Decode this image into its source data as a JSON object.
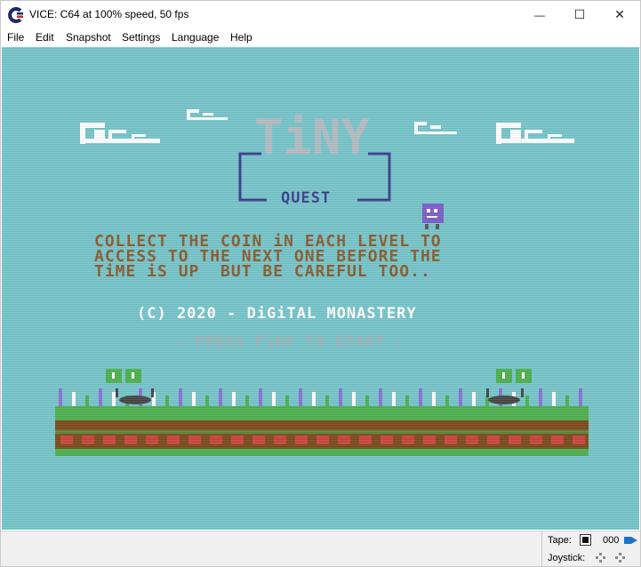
{
  "window": {
    "title": "VICE: C64 at 100% speed, 50 fps",
    "minimize_glyph": "—",
    "maximize_glyph": "☐",
    "close_glyph": "✕"
  },
  "menu": [
    {
      "label": "File"
    },
    {
      "label": "Edit"
    },
    {
      "label": "Snapshot"
    },
    {
      "label": "Settings"
    },
    {
      "label": "Language"
    },
    {
      "label": "Help"
    }
  ],
  "game": {
    "logo_title": "TiNY",
    "logo_subtitle": "QUEST",
    "instructions": [
      "COLLECT THE COIN iN EACH LEVEL TO",
      "ACCESS TO THE NEXT ONE BEFORE THE",
      "TiME iS UP  BUT BE CAREFUL TOO.."
    ],
    "copyright": "(C) 2020 - DiGiTAL MONASTERY",
    "press_fire": "- PRESS FiRE TO START -"
  },
  "status": {
    "tape_label": "Tape:",
    "tape_counter": "000",
    "joystick_label": "Joystick:"
  },
  "colors": {
    "screen_bg": "#75c5cb",
    "text_brown": "#8a5a2b",
    "grass_green": "#4bb04b",
    "dirt_brown": "#7a4a1a",
    "logo_blue": "#3a3c8c",
    "tape_accent": "#1e73c8"
  }
}
